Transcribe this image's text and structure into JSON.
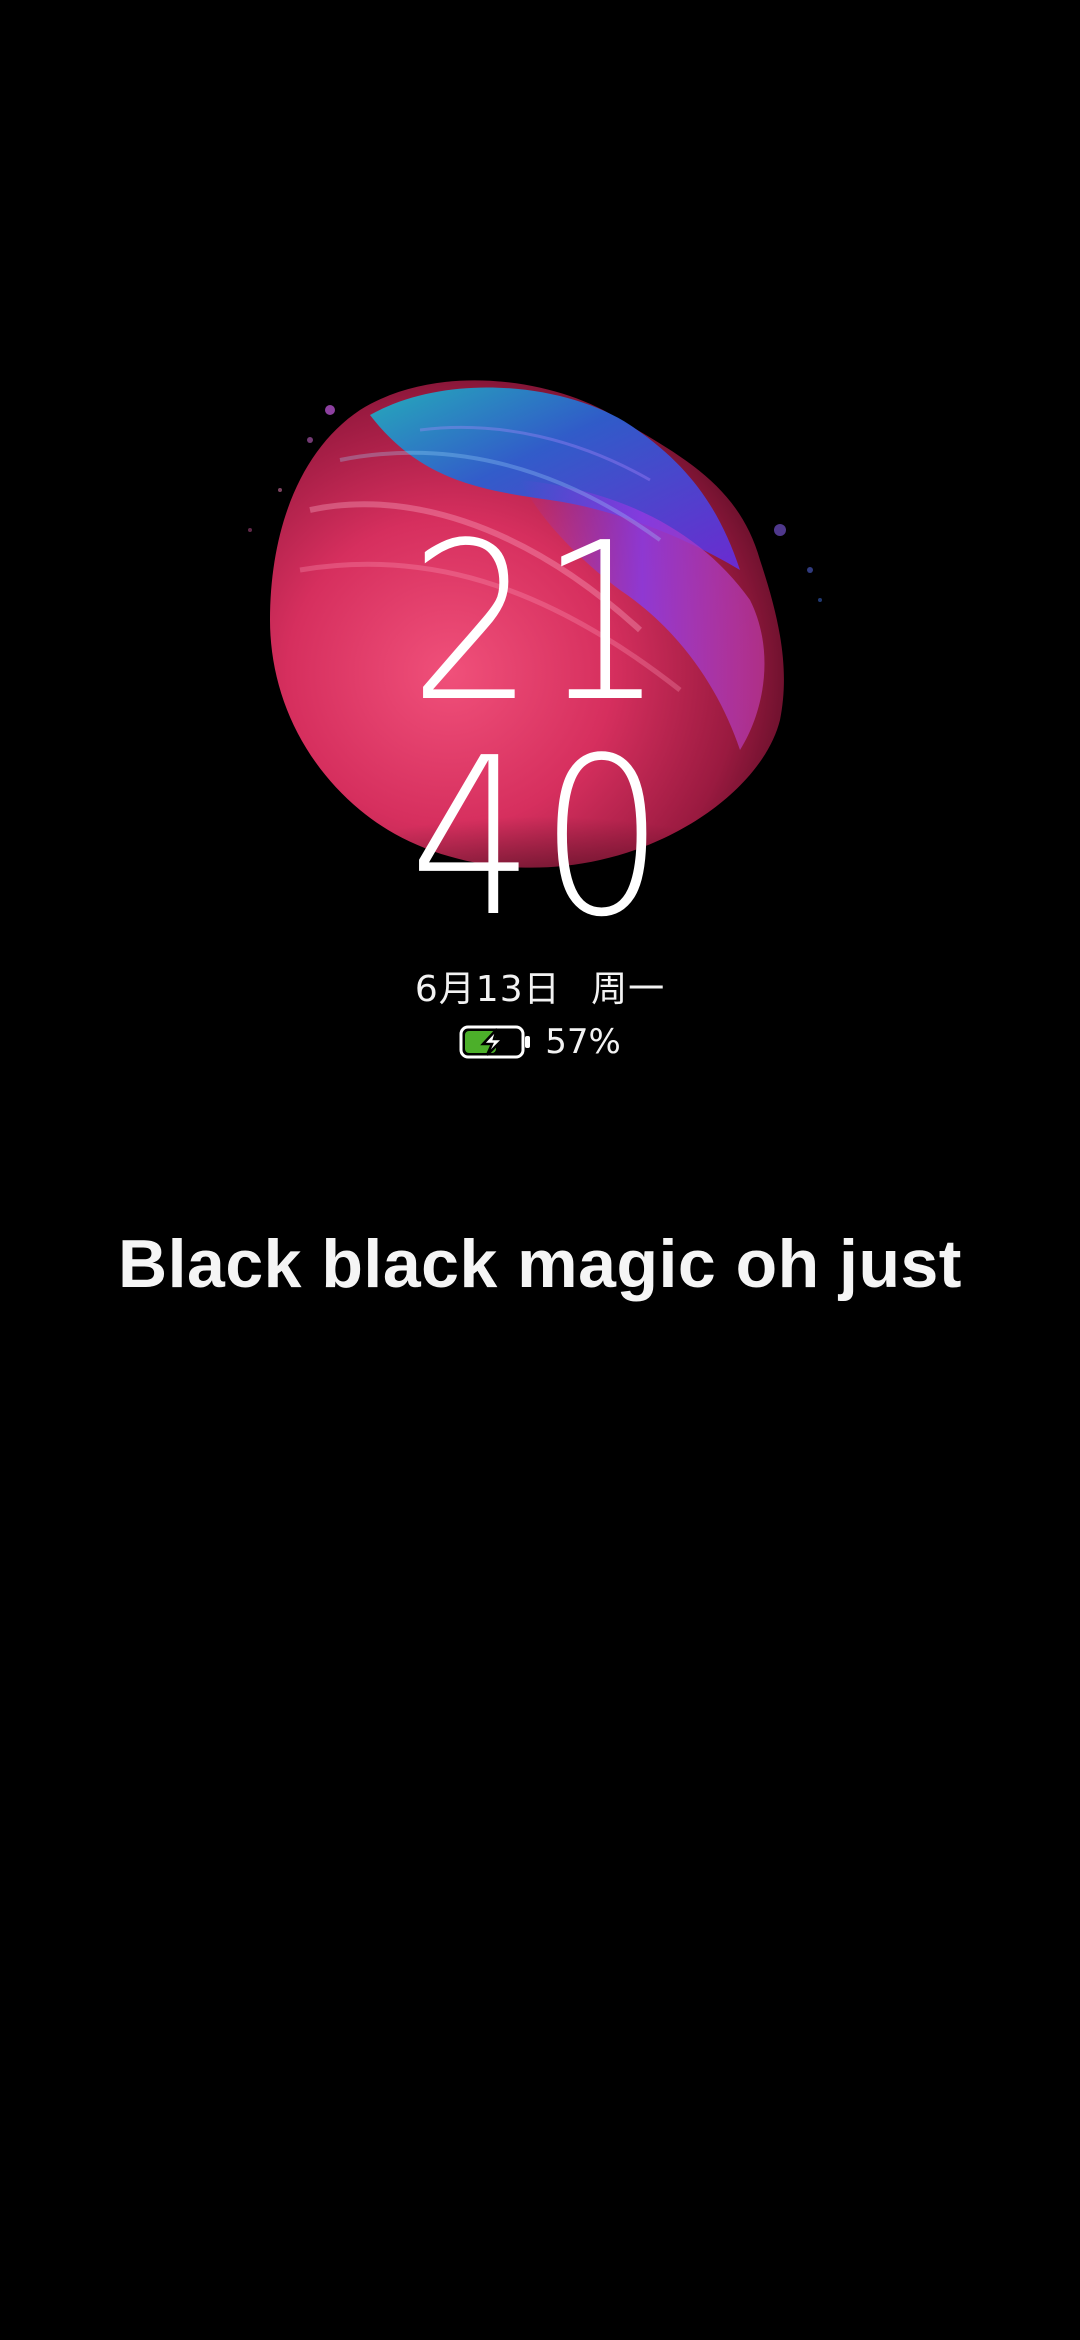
{
  "lockscreen": {
    "clock": {
      "hours": "21",
      "minutes": "40"
    },
    "date": {
      "month_day": "6月13日",
      "weekday": "周一"
    },
    "battery": {
      "percent_label": "57%",
      "level": 0.57,
      "charging": true,
      "icon": "battery-charging-icon",
      "color": "#4caf2a"
    },
    "lyric": "Black black magic oh just",
    "artwork": {
      "icon": "wallpaper-paint-blob",
      "colors": [
        "#e23a6a",
        "#3a5fd0",
        "#8a2be2",
        "#1fa0b0"
      ]
    }
  }
}
